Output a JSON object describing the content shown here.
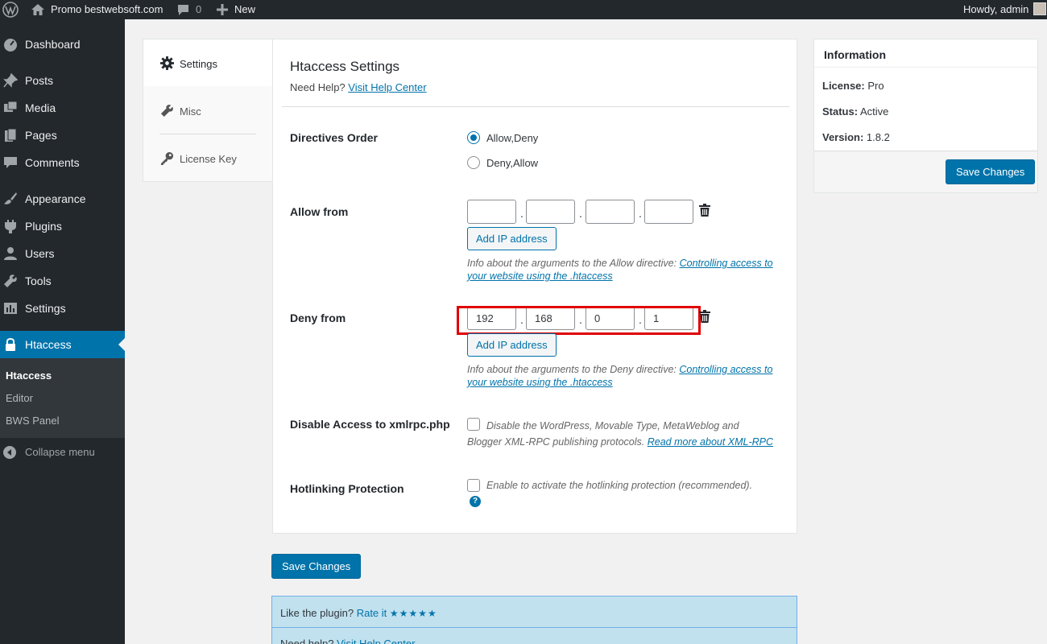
{
  "admin_bar": {
    "site_name": "Promo bestwebsoft.com",
    "comments_count": "0",
    "new_label": "New",
    "howdy": "Howdy, admin"
  },
  "sidebar": {
    "items": [
      {
        "label": "Dashboard",
        "icon": "dashboard-icon"
      },
      {
        "label": "Posts",
        "icon": "pin-icon"
      },
      {
        "label": "Media",
        "icon": "media-icon"
      },
      {
        "label": "Pages",
        "icon": "pages-icon"
      },
      {
        "label": "Comments",
        "icon": "comment-icon"
      },
      {
        "label": "Appearance",
        "icon": "brush-icon"
      },
      {
        "label": "Plugins",
        "icon": "plugin-icon"
      },
      {
        "label": "Users",
        "icon": "user-icon"
      },
      {
        "label": "Tools",
        "icon": "wrench-icon"
      },
      {
        "label": "Settings",
        "icon": "settings-icon"
      },
      {
        "label": "Htaccess",
        "icon": "lock-icon"
      }
    ],
    "submenu": [
      "Htaccess",
      "Editor",
      "BWS Panel"
    ],
    "collapse_label": "Collapse menu"
  },
  "tabs": [
    {
      "label": "Settings",
      "icon": "gear-icon"
    },
    {
      "label": "Misc",
      "icon": "wrench-icon"
    },
    {
      "label": "License Key",
      "icon": "key-icon"
    }
  ],
  "main": {
    "title": "Htaccess Settings",
    "help_prefix": "Need Help?",
    "help_link": "Visit Help Center",
    "directives": {
      "label": "Directives Order",
      "options": [
        "Allow,Deny",
        "Deny,Allow"
      ],
      "selected": "Allow,Deny"
    },
    "allow": {
      "label": "Allow from",
      "octets": [
        "",
        "",
        "",
        ""
      ],
      "add_button": "Add IP address",
      "info_prefix": "Info about the arguments to the Allow directive:",
      "info_link": "Controlling access to your website using the .htaccess"
    },
    "deny": {
      "label": "Deny from",
      "octets": [
        "192",
        "168",
        "0",
        "1"
      ],
      "add_button": "Add IP address",
      "info_prefix": "Info about the arguments to the Deny directive:",
      "info_link": "Controlling access to your website using the .htaccess"
    },
    "xmlrpc": {
      "label": "Disable Access to xmlrpc.php",
      "desc": "Disable the WordPress, Movable Type, MetaWeblog and Blogger XML-RPC publishing protocols.",
      "link": "Read more about XML-RPC"
    },
    "hotlink": {
      "label": "Hotlinking Protection",
      "desc": "Enable to activate the hotlinking protection (recommended)."
    },
    "dot": ".",
    "help_icon": "?"
  },
  "save_button": "Save Changes",
  "info_box": {
    "title": "Information",
    "license_label": "License:",
    "license_value": "Pro",
    "status_label": "Status:",
    "status_value": "Active",
    "version_label": "Version:",
    "version_value": "1.8.2",
    "save_button": "Save Changes"
  },
  "rate": {
    "prefix": "Like the plugin?",
    "link": "Rate it",
    "stars": "★★★★★"
  },
  "help_box": {
    "prefix": "Need help?",
    "link": "Visit Help Center"
  },
  "colors": {
    "accent": "#0073aa",
    "sidebar_bg": "#23282d",
    "highlight": "#e00000"
  }
}
